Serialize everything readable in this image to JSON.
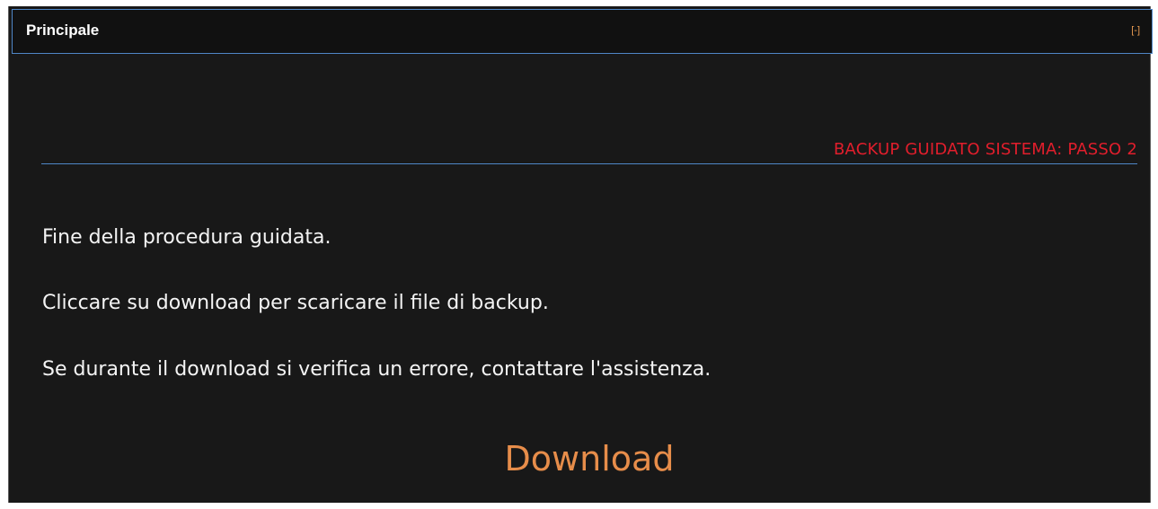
{
  "panel": {
    "title": "Principale",
    "collapse_label": "[-]"
  },
  "wizard": {
    "step_title": "BACKUP GUIDATO SISTEMA: PASSO 2",
    "messages": [
      "Fine della procedura guidata.",
      "Cliccare su download per scaricare il file di backup.",
      "Se durante il download si verifica un errore, contattare l'assistenza."
    ],
    "download_label": "Download"
  },
  "colors": {
    "background": "#181818",
    "header_border": "#4f86c6",
    "accent_red": "#e11e2c",
    "link_orange": "#e78d4a"
  }
}
